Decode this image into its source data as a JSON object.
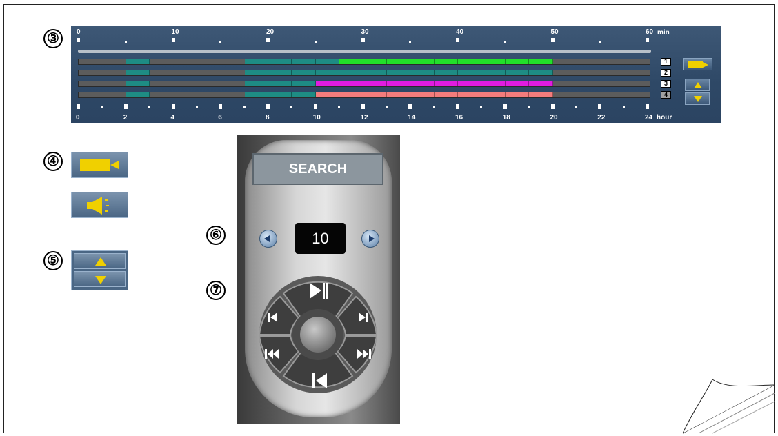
{
  "callouts": {
    "c3": "③",
    "c4": "④",
    "c5": "⑤",
    "c6": "⑥",
    "c7": "⑦"
  },
  "timeline": {
    "min_labels": [
      "0",
      "10",
      "20",
      "30",
      "40",
      "50",
      "60"
    ],
    "min_unit": "min",
    "hour_labels": [
      "0",
      "2",
      "4",
      "6",
      "8",
      "10",
      "12",
      "14",
      "16",
      "18",
      "20",
      "22",
      "24"
    ],
    "hour_unit": "hour",
    "channels": [
      "1",
      "2",
      "3",
      "4"
    ],
    "colors": {
      "track": "#5c5c5c",
      "teal": "#1e8c84",
      "green": "#22e02a",
      "magenta": "#e01ce0",
      "salmon": "#f47c7c",
      "accent": "#f0d000"
    }
  },
  "remote": {
    "title": "SEARCH",
    "display_value": "10"
  }
}
